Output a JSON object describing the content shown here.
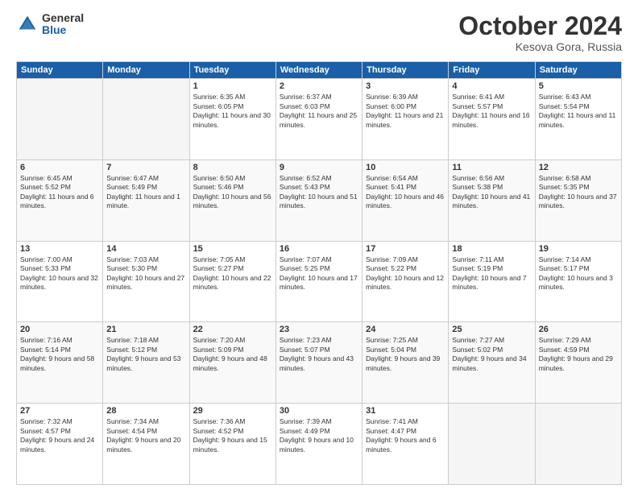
{
  "header": {
    "logo_general": "General",
    "logo_blue": "Blue",
    "month_title": "October 2024",
    "subtitle": "Kesova Gora, Russia"
  },
  "days_of_week": [
    "Sunday",
    "Monday",
    "Tuesday",
    "Wednesday",
    "Thursday",
    "Friday",
    "Saturday"
  ],
  "weeks": [
    [
      {
        "day": "",
        "sunrise": "",
        "sunset": "",
        "daylight": ""
      },
      {
        "day": "",
        "sunrise": "",
        "sunset": "",
        "daylight": ""
      },
      {
        "day": "1",
        "sunrise": "Sunrise: 6:35 AM",
        "sunset": "Sunset: 6:05 PM",
        "daylight": "Daylight: 11 hours and 30 minutes."
      },
      {
        "day": "2",
        "sunrise": "Sunrise: 6:37 AM",
        "sunset": "Sunset: 6:03 PM",
        "daylight": "Daylight: 11 hours and 25 minutes."
      },
      {
        "day": "3",
        "sunrise": "Sunrise: 6:39 AM",
        "sunset": "Sunset: 6:00 PM",
        "daylight": "Daylight: 11 hours and 21 minutes."
      },
      {
        "day": "4",
        "sunrise": "Sunrise: 6:41 AM",
        "sunset": "Sunset: 5:57 PM",
        "daylight": "Daylight: 11 hours and 16 minutes."
      },
      {
        "day": "5",
        "sunrise": "Sunrise: 6:43 AM",
        "sunset": "Sunset: 5:54 PM",
        "daylight": "Daylight: 11 hours and 11 minutes."
      }
    ],
    [
      {
        "day": "6",
        "sunrise": "Sunrise: 6:45 AM",
        "sunset": "Sunset: 5:52 PM",
        "daylight": "Daylight: 11 hours and 6 minutes."
      },
      {
        "day": "7",
        "sunrise": "Sunrise: 6:47 AM",
        "sunset": "Sunset: 5:49 PM",
        "daylight": "Daylight: 11 hours and 1 minute."
      },
      {
        "day": "8",
        "sunrise": "Sunrise: 6:50 AM",
        "sunset": "Sunset: 5:46 PM",
        "daylight": "Daylight: 10 hours and 56 minutes."
      },
      {
        "day": "9",
        "sunrise": "Sunrise: 6:52 AM",
        "sunset": "Sunset: 5:43 PM",
        "daylight": "Daylight: 10 hours and 51 minutes."
      },
      {
        "day": "10",
        "sunrise": "Sunrise: 6:54 AM",
        "sunset": "Sunset: 5:41 PM",
        "daylight": "Daylight: 10 hours and 46 minutes."
      },
      {
        "day": "11",
        "sunrise": "Sunrise: 6:56 AM",
        "sunset": "Sunset: 5:38 PM",
        "daylight": "Daylight: 10 hours and 41 minutes."
      },
      {
        "day": "12",
        "sunrise": "Sunrise: 6:58 AM",
        "sunset": "Sunset: 5:35 PM",
        "daylight": "Daylight: 10 hours and 37 minutes."
      }
    ],
    [
      {
        "day": "13",
        "sunrise": "Sunrise: 7:00 AM",
        "sunset": "Sunset: 5:33 PM",
        "daylight": "Daylight: 10 hours and 32 minutes."
      },
      {
        "day": "14",
        "sunrise": "Sunrise: 7:03 AM",
        "sunset": "Sunset: 5:30 PM",
        "daylight": "Daylight: 10 hours and 27 minutes."
      },
      {
        "day": "15",
        "sunrise": "Sunrise: 7:05 AM",
        "sunset": "Sunset: 5:27 PM",
        "daylight": "Daylight: 10 hours and 22 minutes."
      },
      {
        "day": "16",
        "sunrise": "Sunrise: 7:07 AM",
        "sunset": "Sunset: 5:25 PM",
        "daylight": "Daylight: 10 hours and 17 minutes."
      },
      {
        "day": "17",
        "sunrise": "Sunrise: 7:09 AM",
        "sunset": "Sunset: 5:22 PM",
        "daylight": "Daylight: 10 hours and 12 minutes."
      },
      {
        "day": "18",
        "sunrise": "Sunrise: 7:11 AM",
        "sunset": "Sunset: 5:19 PM",
        "daylight": "Daylight: 10 hours and 7 minutes."
      },
      {
        "day": "19",
        "sunrise": "Sunrise: 7:14 AM",
        "sunset": "Sunset: 5:17 PM",
        "daylight": "Daylight: 10 hours and 3 minutes."
      }
    ],
    [
      {
        "day": "20",
        "sunrise": "Sunrise: 7:16 AM",
        "sunset": "Sunset: 5:14 PM",
        "daylight": "Daylight: 9 hours and 58 minutes."
      },
      {
        "day": "21",
        "sunrise": "Sunrise: 7:18 AM",
        "sunset": "Sunset: 5:12 PM",
        "daylight": "Daylight: 9 hours and 53 minutes."
      },
      {
        "day": "22",
        "sunrise": "Sunrise: 7:20 AM",
        "sunset": "Sunset: 5:09 PM",
        "daylight": "Daylight: 9 hours and 48 minutes."
      },
      {
        "day": "23",
        "sunrise": "Sunrise: 7:23 AM",
        "sunset": "Sunset: 5:07 PM",
        "daylight": "Daylight: 9 hours and 43 minutes."
      },
      {
        "day": "24",
        "sunrise": "Sunrise: 7:25 AM",
        "sunset": "Sunset: 5:04 PM",
        "daylight": "Daylight: 9 hours and 39 minutes."
      },
      {
        "day": "25",
        "sunrise": "Sunrise: 7:27 AM",
        "sunset": "Sunset: 5:02 PM",
        "daylight": "Daylight: 9 hours and 34 minutes."
      },
      {
        "day": "26",
        "sunrise": "Sunrise: 7:29 AM",
        "sunset": "Sunset: 4:59 PM",
        "daylight": "Daylight: 9 hours and 29 minutes."
      }
    ],
    [
      {
        "day": "27",
        "sunrise": "Sunrise: 7:32 AM",
        "sunset": "Sunset: 4:57 PM",
        "daylight": "Daylight: 9 hours and 24 minutes."
      },
      {
        "day": "28",
        "sunrise": "Sunrise: 7:34 AM",
        "sunset": "Sunset: 4:54 PM",
        "daylight": "Daylight: 9 hours and 20 minutes."
      },
      {
        "day": "29",
        "sunrise": "Sunrise: 7:36 AM",
        "sunset": "Sunset: 4:52 PM",
        "daylight": "Daylight: 9 hours and 15 minutes."
      },
      {
        "day": "30",
        "sunrise": "Sunrise: 7:39 AM",
        "sunset": "Sunset: 4:49 PM",
        "daylight": "Daylight: 9 hours and 10 minutes."
      },
      {
        "day": "31",
        "sunrise": "Sunrise: 7:41 AM",
        "sunset": "Sunset: 4:47 PM",
        "daylight": "Daylight: 9 hours and 6 minutes."
      },
      {
        "day": "",
        "sunrise": "",
        "sunset": "",
        "daylight": ""
      },
      {
        "day": "",
        "sunrise": "",
        "sunset": "",
        "daylight": ""
      }
    ]
  ]
}
